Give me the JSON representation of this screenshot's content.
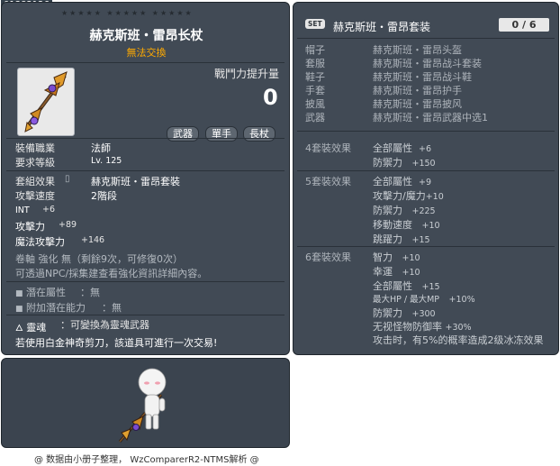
{
  "item_id": "01382126",
  "tooltip": {
    "stars": "★★★★★  ★★★★★  ★★★★★",
    "name": "赫克斯班・雷昂长杖",
    "trade": "無法交換",
    "combat_power_label": "戰鬥力提升量",
    "combat_power_value": "0",
    "tags": [
      "武器",
      "單手",
      "長杖"
    ],
    "job_label": "裝備職業",
    "job_value": "法師",
    "level_label": "要求等級",
    "level_value": "Lv. 125",
    "set_label": "套組效果",
    "set_value": "赫克斯班・雷昂套裝",
    "speed_label": "攻擊速度",
    "speed_value": "2階段",
    "int_label": "INT",
    "int_value": "+6",
    "atk_label": "攻擊力",
    "atk_value": "+89",
    "matk_label": "魔法攻擊力",
    "matk_value": "+146",
    "scroll_line": "卷軸 強化 無（剩餘9次，可修復0次）",
    "npc_line": "可透過NPC/採集建查看強化資訊詳細內容。",
    "potential_label": "潛在屬性",
    "potential_value": "：無",
    "add_potential_label": "附加潛在能力",
    "add_potential_value": "：無",
    "soul_label": "靈魂",
    "soul_value": "：可變換為靈魂武器",
    "scissors_line": "若使用白金神奇剪刀，該道具可進行一次交易!"
  },
  "set_panel": {
    "badge": "SET",
    "title": "赫克斯班・雷昂套装",
    "count": "0 / 6",
    "parts": [
      {
        "slot": "帽子",
        "item": "赫克斯班・雷昂头盔"
      },
      {
        "slot": "套服",
        "item": "赫克斯班・雷昂战斗套装"
      },
      {
        "slot": "鞋子",
        "item": "赫克斯班・雷昂战斗鞋"
      },
      {
        "slot": "手套",
        "item": "赫克斯班・雷昂护手"
      },
      {
        "slot": "披風",
        "item": "赫克斯班・雷昂披风"
      },
      {
        "slot": "武器",
        "item": "赫克斯班・雷昂武器中选1"
      }
    ],
    "effects": [
      {
        "label": "4套裝效果",
        "lines": [
          {
            "name": "全部屬性",
            "value": "+6"
          },
          {
            "name": "防禦力",
            "value": "+150"
          }
        ]
      },
      {
        "label": "5套裝效果",
        "lines": [
          {
            "name": "全部屬性",
            "value": "+9"
          },
          {
            "name": "攻擊力/魔力",
            "value": "+10"
          },
          {
            "name": "防禦力",
            "value": "+225"
          },
          {
            "name": "移動速度",
            "value": "+10"
          },
          {
            "name": "跳躍力",
            "value": "+15"
          }
        ]
      },
      {
        "label": "6套裝效果",
        "lines": [
          {
            "name": "智力",
            "value": "+10"
          },
          {
            "name": "幸運",
            "value": "+10"
          },
          {
            "name": "全部屬性",
            "value": "+15"
          },
          {
            "name": "最大HP / 最大MP",
            "value": "+10%"
          },
          {
            "name": "防禦力",
            "value": "+300"
          },
          {
            "name": "无视怪物防御率",
            "value": "+30%"
          },
          {
            "name": "攻击时，有5%的概率造成2级冰冻效果",
            "value": ""
          }
        ]
      }
    ]
  },
  "footer": "@ 数据由小册子整理， WzComparerR2-NTMS解析 @"
}
